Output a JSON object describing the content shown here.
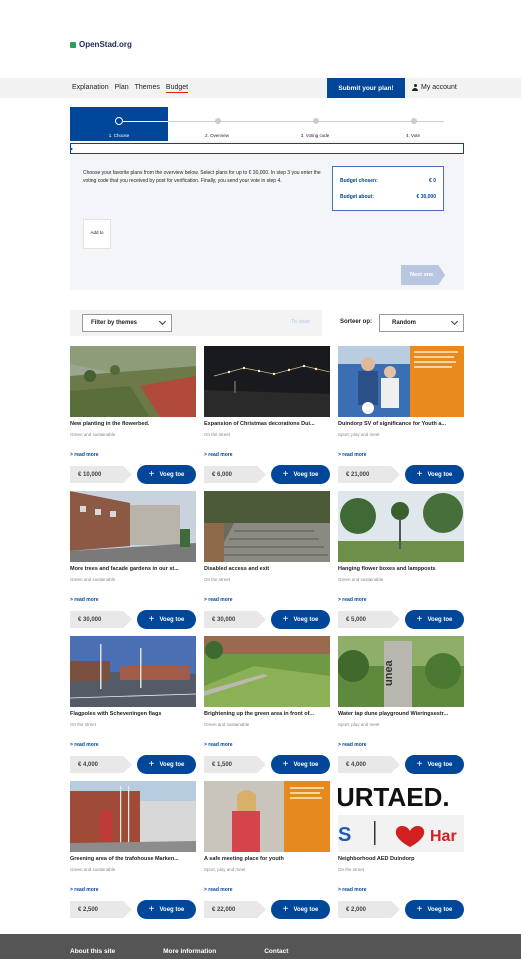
{
  "brand": {
    "name": "OpenStad.org",
    "color": "#2aa35a"
  },
  "nav": {
    "links": [
      "Explanation",
      "Plan",
      "Themes",
      "Budget"
    ],
    "active": "Budget",
    "submit_label": "Submit your plan!",
    "account_label": "My account"
  },
  "steps": [
    {
      "label": "1. Choose",
      "active": true
    },
    {
      "label": "2. Overview",
      "active": false
    },
    {
      "label": "3. Voting code",
      "active": false
    },
    {
      "label": "4. Vote",
      "active": false
    }
  ],
  "budget": {
    "intro": "Choose your favorite plans from the overview below. Select plans for up to € 30,000. In step 3 you enter the voting code that you received by post for verification. Finally, you send your vote in step 4.",
    "chosen_label": "Budget chosen:",
    "chosen_value": "€ 0",
    "about_label": "Budget about:",
    "about_value": "€ 30,000",
    "add_label": "Add to",
    "next_label": "Next one"
  },
  "filters": {
    "theme_label": "Filter by themes",
    "reset_label": "To clear",
    "sort_label": "Sorteer op:",
    "sort_value": "Random"
  },
  "add_button_label": "Voeg toe",
  "read_more_label": "> read more",
  "plans": [
    {
      "title": "New planting in the flowerbed.",
      "theme": "Green and sustainable",
      "price": "€ 10,000"
    },
    {
      "title": "Expansion of Christmas decorations Dui...",
      "theme": "On the street",
      "price": "€ 6,000"
    },
    {
      "title": "Duindorp SV of significance for Youth a...",
      "theme": "Sport, play and meet",
      "price": "€ 21,000"
    },
    {
      "title": "More trees and facade gardens in our st...",
      "theme": "Green and sustainable",
      "price": "€ 30,000"
    },
    {
      "title": "Disabled access and exit",
      "theme": "On the street",
      "price": "€ 30,000"
    },
    {
      "title": "Hanging flower boxes and lampposts",
      "theme": "Green and sustainable",
      "price": "€ 5,000"
    },
    {
      "title": "Flagpoles with Scheveningen flags",
      "theme": "On the street",
      "price": "€ 4,000"
    },
    {
      "title": "Brightening up the green area in front of...",
      "theme": "Green and sustainable",
      "price": "€ 1,500"
    },
    {
      "title": "Water tap dune playground Wieringsestr...",
      "theme": "Sport, play and meet",
      "price": "€ 4,000"
    },
    {
      "title": "Greening area of the trafohouse Marken...",
      "theme": "Green and sustainable",
      "price": "€ 2,500"
    },
    {
      "title": "A safe meeting place for youth",
      "theme": "Sport, play and meet",
      "price": "€ 22,000"
    },
    {
      "title": "Neighborhood AED Duindorp",
      "theme": "On the street",
      "price": "€ 2,000"
    }
  ],
  "image_texts": {
    "aed_top": "URTAED.",
    "aed_s": "S",
    "aed_har": "Har",
    "unea": "unea"
  },
  "footer": {
    "links": [
      "About this site",
      "More information",
      "Contact"
    ]
  },
  "colors": {
    "primary": "#004699",
    "accent": "#d21f1f",
    "footer": "#555555"
  }
}
